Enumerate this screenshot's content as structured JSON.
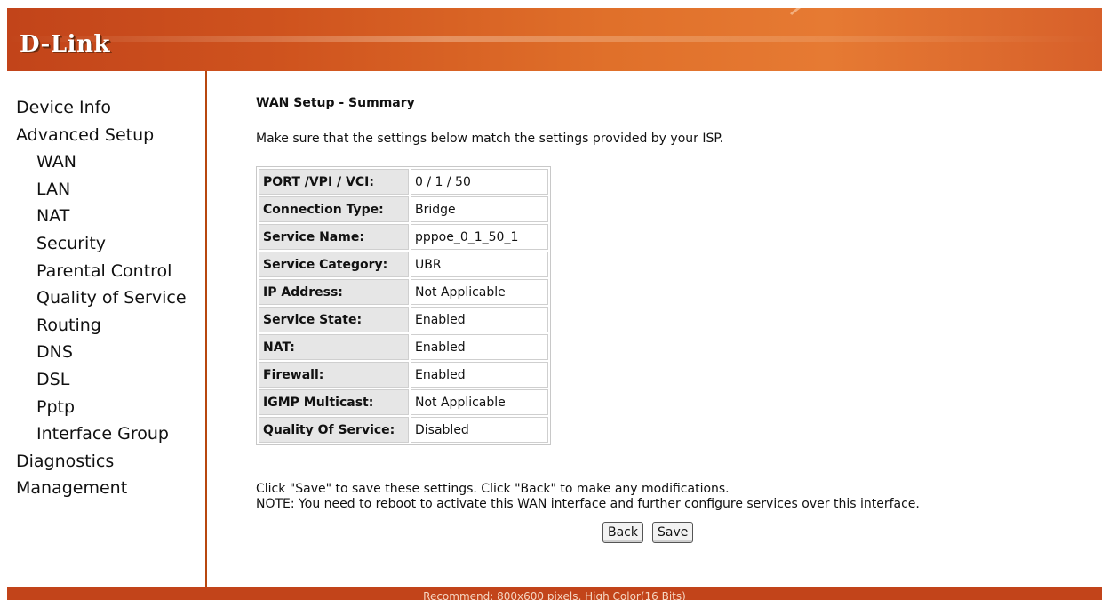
{
  "header": {
    "logo": "D-Link"
  },
  "sidebar": {
    "items": [
      {
        "label": "Device Info",
        "level": 0
      },
      {
        "label": "Advanced Setup",
        "level": 0
      },
      {
        "label": "WAN",
        "level": 1
      },
      {
        "label": "LAN",
        "level": 1
      },
      {
        "label": "NAT",
        "level": 1
      },
      {
        "label": "Security",
        "level": 1
      },
      {
        "label": "Parental Control",
        "level": 1
      },
      {
        "label": "Quality of Service",
        "level": 1
      },
      {
        "label": "Routing",
        "level": 1
      },
      {
        "label": "DNS",
        "level": 1
      },
      {
        "label": "DSL",
        "level": 1
      },
      {
        "label": "Pptp",
        "level": 1
      },
      {
        "label": "Interface Group",
        "level": 1
      },
      {
        "label": "Diagnostics",
        "level": 0
      },
      {
        "label": "Management",
        "level": 0
      }
    ]
  },
  "main": {
    "title": "WAN Setup - Summary",
    "intro": "Make sure that the settings below match the settings provided by your ISP.",
    "summary": [
      {
        "label": "PORT /VPI / VCI:",
        "value": "0 / 1 / 50"
      },
      {
        "label": "Connection Type:",
        "value": "Bridge"
      },
      {
        "label": "Service Name:",
        "value": "pppoe_0_1_50_1"
      },
      {
        "label": "Service Category:",
        "value": "UBR"
      },
      {
        "label": "IP Address:",
        "value": "Not Applicable"
      },
      {
        "label": "Service State:",
        "value": "Enabled"
      },
      {
        "label": "NAT:",
        "value": "Enabled"
      },
      {
        "label": "Firewall:",
        "value": "Enabled"
      },
      {
        "label": "IGMP Multicast:",
        "value": "Not Applicable"
      },
      {
        "label": "Quality Of Service:",
        "value": "Disabled"
      }
    ],
    "note1": "Click \"Save\" to save these settings. Click \"Back\" to make any modifications.",
    "note2": "NOTE: You need to reboot to activate this WAN interface and further configure services over this interface.",
    "back_label": "Back",
    "save_label": "Save"
  },
  "footer": {
    "text": "Recommend: 800x600 pixels, High Color(16 Bits)"
  },
  "colors": {
    "brand_orange": "#c2441a",
    "banner_light": "#e67a33"
  }
}
